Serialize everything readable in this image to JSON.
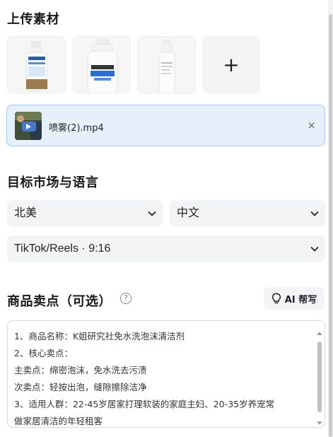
{
  "upload": {
    "title": "上传素材",
    "add_label": "+",
    "products": [
      {
        "name": "product-thumb-spray-bottle"
      },
      {
        "name": "product-thumb-foam-cleaner"
      },
      {
        "name": "product-thumb-white-bottle"
      }
    ],
    "video": {
      "filename": "喷雾(2).mp4",
      "close": "×"
    }
  },
  "market": {
    "title": "目标市场与语言",
    "region": "北美",
    "language": "中文",
    "platform": "TikTok/Reels · 9:16"
  },
  "selling_points": {
    "title": "商品卖点（可选）",
    "help": "?",
    "ai_button": "AI 帮写",
    "lines": [
      "1、商品名称：K姐研究社免水洗泡沫清洁剂",
      "2、核心卖点：",
      "主卖点：绵密泡沫，免水洗去污渍",
      "次卖点：轻按出泡，缝隙擦除洁净",
      "3、适用人群：22-45岁居家打理软装的家庭主妇、20-35岁养宠常",
      "做家居清洁的年轻租客"
    ]
  },
  "colors": {
    "accent_bg": "#e6f0fb",
    "accent_border": "#a9c8ef",
    "field_bg": "#f3f4f6"
  },
  "icons": {
    "chevron": "chevron-down-icon",
    "bulb": "lightbulb-icon",
    "play": "play-icon",
    "help": "question-circle-icon"
  }
}
